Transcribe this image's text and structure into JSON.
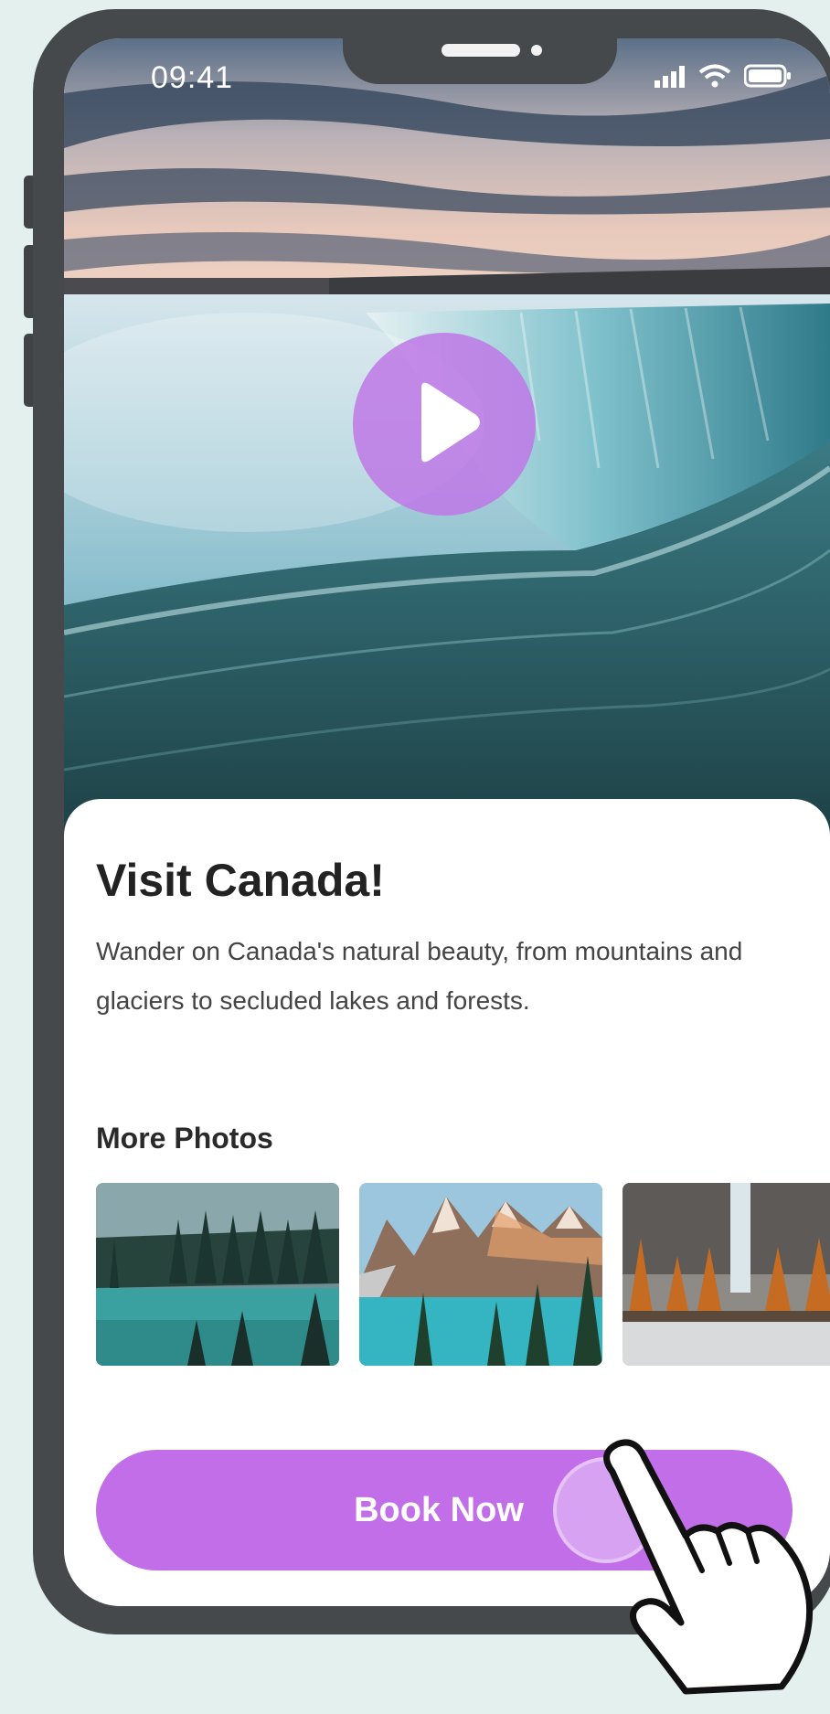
{
  "status_bar": {
    "time": "09:41",
    "icons": [
      "signal-icon",
      "wifi-icon",
      "battery-icon"
    ]
  },
  "hero": {
    "image": "waterfall-photo",
    "play_icon": "play-icon"
  },
  "card": {
    "title": "Visit Canada!",
    "description": "Wander on Canada's natural beauty, from mountains and glaciers to secluded lakes and forests.",
    "more_photos_title": "More Photos",
    "photos": [
      {
        "name": "forest-lake-photo"
      },
      {
        "name": "mountain-lake-photo"
      },
      {
        "name": "autumn-waterfall-photo"
      }
    ],
    "book_button_label": "Book Now"
  },
  "colors": {
    "accent": "#c26ee8",
    "play_button": "#be78e6",
    "phone_frame": "#45494c",
    "background": "#e3f0ee"
  }
}
